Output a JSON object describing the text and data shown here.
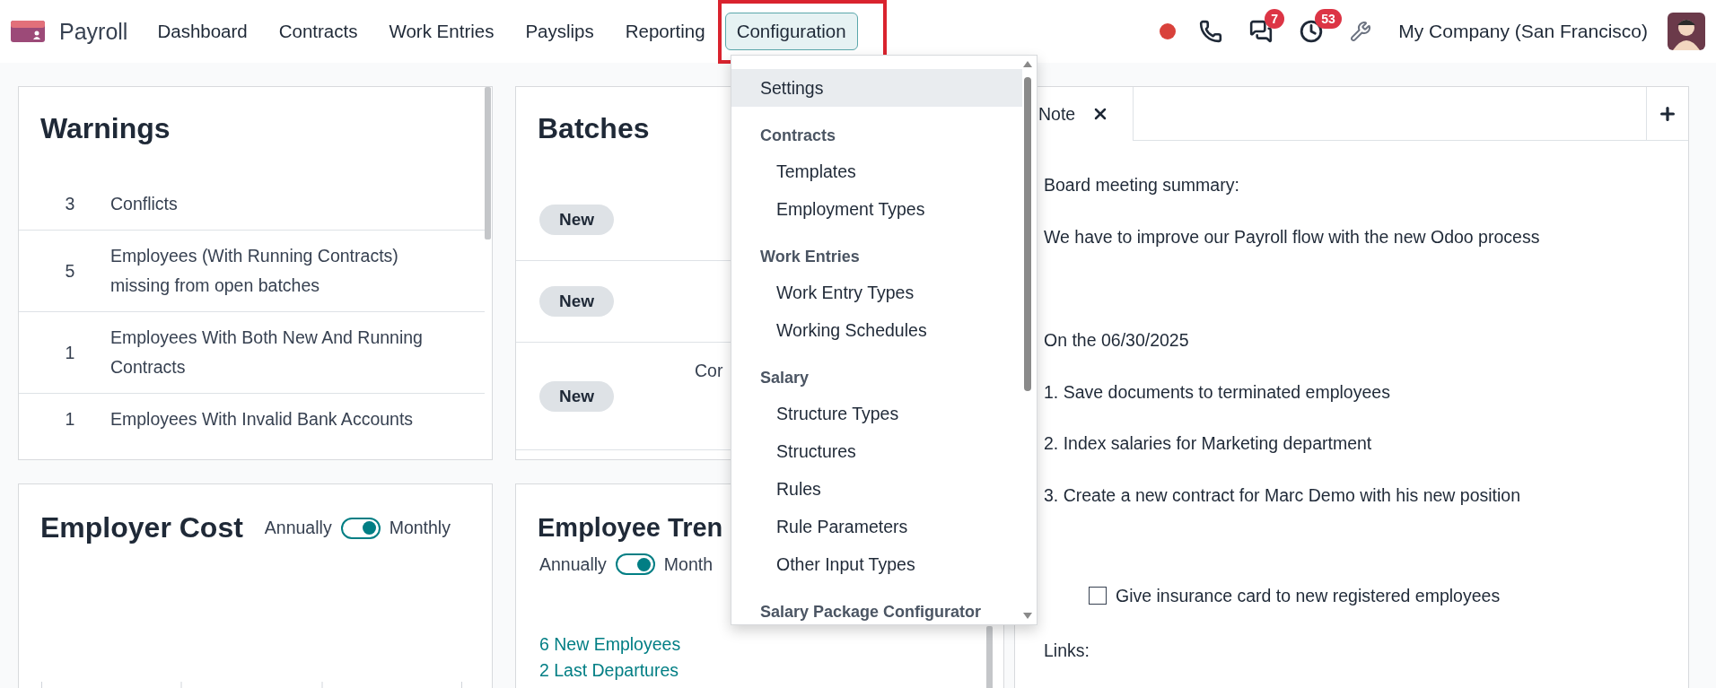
{
  "app": {
    "name": "Payroll"
  },
  "nav": [
    {
      "label": "Dashboard",
      "selected": false
    },
    {
      "label": "Contracts",
      "selected": false
    },
    {
      "label": "Work Entries",
      "selected": false
    },
    {
      "label": "Payslips",
      "selected": false
    },
    {
      "label": "Reporting",
      "selected": false
    },
    {
      "label": "Configuration",
      "selected": true
    }
  ],
  "systray": {
    "messages_badge": "7",
    "activities_badge": "53",
    "company": "My Company (San Francisco)"
  },
  "warnings": {
    "title": "Warnings",
    "rows": [
      {
        "count": "3",
        "label": "Conflicts"
      },
      {
        "count": "5",
        "label": "Employees (With Running Contracts) missing from open batches"
      },
      {
        "count": "1",
        "label": "Employees With Both New And Running Contracts"
      },
      {
        "count": "1",
        "label": "Employees With Invalid Bank Accounts"
      }
    ]
  },
  "batches": {
    "title": "Batches",
    "rows": [
      {
        "state": "New"
      },
      {
        "state": "New"
      },
      {
        "state": "New",
        "column_2": "Cor"
      }
    ]
  },
  "employer_cost": {
    "title": "Employer Cost",
    "toggle": {
      "left": "Annually",
      "right": "Monthly",
      "on": true
    }
  },
  "employee_trends": {
    "title": "Employee Tren",
    "toggle": {
      "left": "Annually",
      "right": "Month",
      "on": true
    },
    "links": [
      "6 New Employees",
      "2 Last Departures"
    ]
  },
  "note": {
    "tab": "Note",
    "groups": [
      {
        "kind": "text",
        "lines": [
          "Board meeting summary:",
          "We have to improve our Payroll flow with the new Odoo process"
        ]
      },
      {
        "kind": "text",
        "lines": [
          "On the 06/30/2025",
          "1. Save documents to terminated employees",
          "2. Index salaries for Marketing department",
          "3. Create a new contract for Marc Demo with his new position"
        ]
      },
      {
        "kind": "checklist",
        "items": [
          {
            "label": "Give insurance card to new registered employees",
            "checked": false
          }
        ]
      },
      {
        "kind": "text",
        "lines": [
          "Links:"
        ]
      }
    ]
  },
  "dropdown": {
    "items": [
      {
        "label": "Settings",
        "selected": true
      }
    ],
    "sections": [
      {
        "title": "Contracts",
        "items": [
          {
            "label": "Templates",
            "selected": false
          },
          {
            "label": "Employment Types",
            "selected": false
          }
        ]
      },
      {
        "title": "Work Entries",
        "items": [
          {
            "label": "Work Entry Types",
            "selected": false
          },
          {
            "label": "Working Schedules",
            "selected": false
          }
        ]
      },
      {
        "title": "Salary",
        "items": [
          {
            "label": "Structure Types",
            "selected": false
          },
          {
            "label": "Structures",
            "selected": false
          },
          {
            "label": "Rules",
            "selected": false
          },
          {
            "label": "Rule Parameters",
            "selected": false
          },
          {
            "label": "Other Input Types",
            "selected": false
          }
        ]
      },
      {
        "title": "Salary Package Configurator"
      }
    ]
  }
}
